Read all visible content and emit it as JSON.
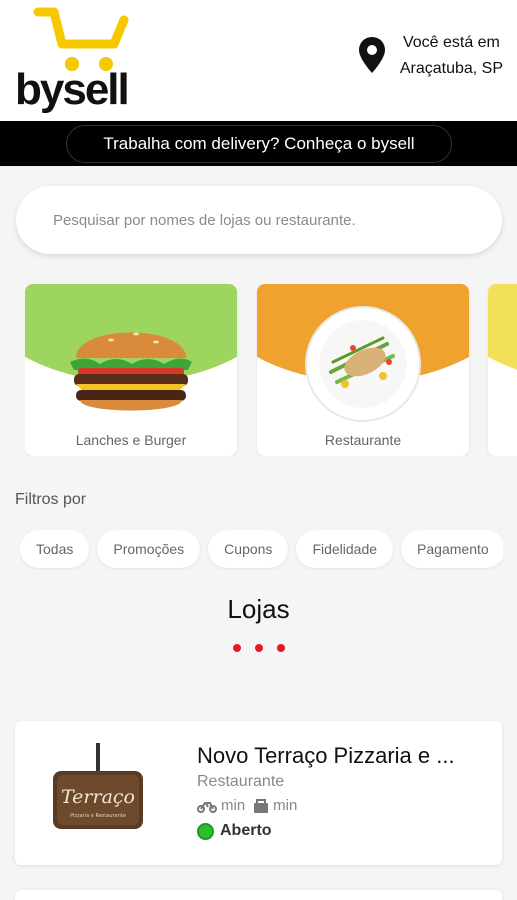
{
  "header": {
    "logo_text": "bysell",
    "location_line1": "Você está em",
    "location_line2": "Araçatuba, SP"
  },
  "banner": {
    "text": "Trabalha com delivery? Conheça o bysell"
  },
  "search": {
    "placeholder": "Pesquisar por nomes de lojas ou restaurante."
  },
  "categories": [
    {
      "label": "Lanches e Burger",
      "color": "#9ed55f",
      "icon": "burger-image"
    },
    {
      "label": "Restaurante",
      "color": "#f0a22e",
      "icon": "plate-image"
    },
    {
      "label": "",
      "color": "#f2e05a",
      "icon": "partial-card"
    }
  ],
  "filters": {
    "title": "Filtros por",
    "chips": [
      "Todas",
      "Promoções",
      "Cupons",
      "Fidelidade",
      "Pagamento"
    ]
  },
  "stores_section": {
    "title": "Lojas"
  },
  "stores": [
    {
      "name": "Novo Terraço Pizzaria e ...",
      "type": "Restaurante",
      "delivery_time": "min",
      "pickup_time": "min",
      "status": "Aberto",
      "logo_text": "Terraço",
      "logo_subtitle": "Pizzaria e Restaurante"
    }
  ],
  "colors": {
    "brand_yellow": "#f5c800",
    "accent_red": "#e31b23",
    "open_green": "#2ebd2e"
  }
}
